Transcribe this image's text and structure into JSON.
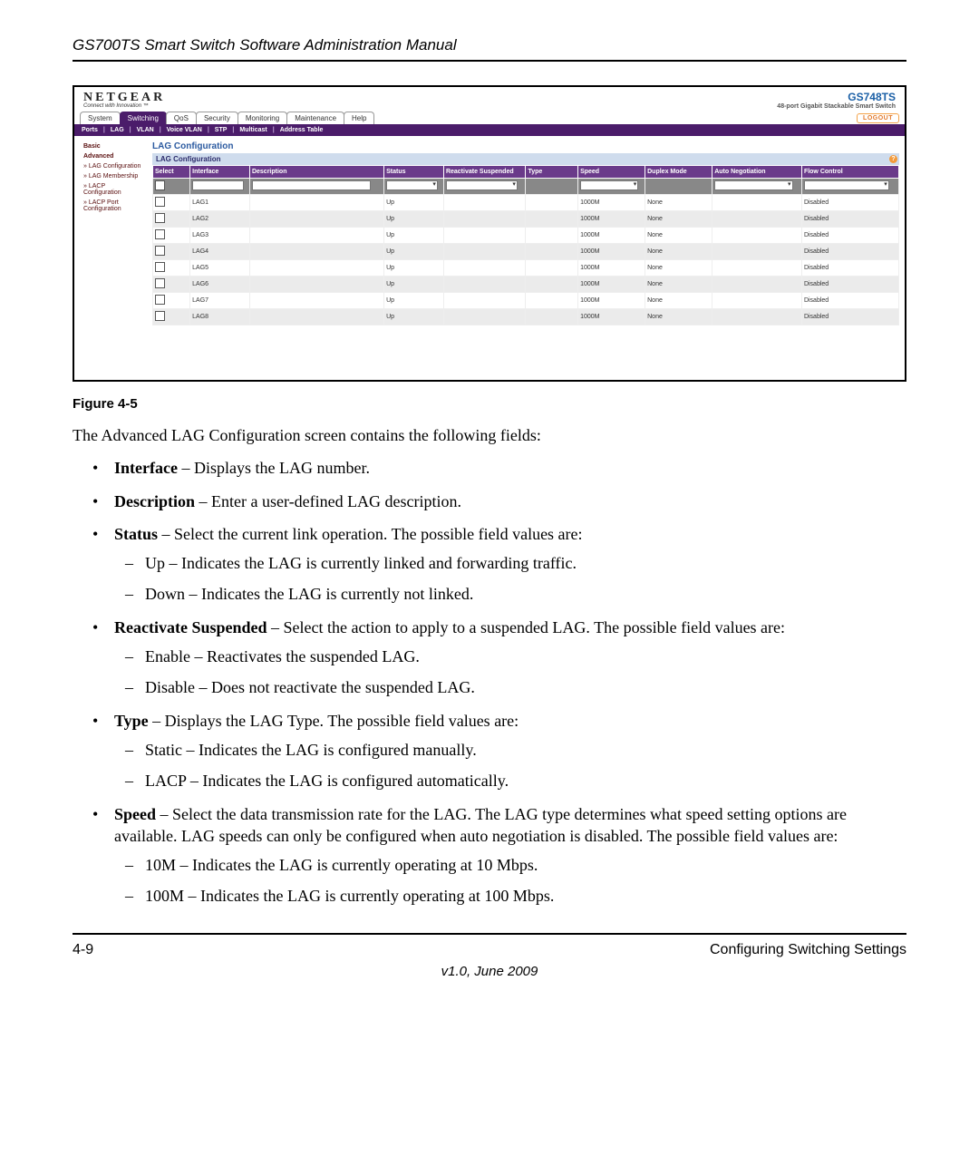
{
  "running_header": "GS700TS Smart Switch Software Administration Manual",
  "figure": {
    "brand": "NETGEAR",
    "brand_tag": "Connect with Innovation ™",
    "product_code": "GS748TS",
    "product_sub": "48-port Gigabit Stackable Smart Switch",
    "nav_tabs": [
      "System",
      "Switching",
      "QoS",
      "Security",
      "Monitoring",
      "Maintenance",
      "Help"
    ],
    "nav_active": "Switching",
    "logout": "LOGOUT",
    "subnav": [
      "Ports",
      "LAG",
      "VLAN",
      "Voice VLAN",
      "STP",
      "Multicast",
      "Address Table"
    ],
    "side": [
      {
        "label": "Basic",
        "cls": "head"
      },
      {
        "label": "Advanced",
        "cls": "head"
      },
      {
        "label": "» LAG Configuration",
        "cls": ""
      },
      {
        "label": "» LAG Membership",
        "cls": ""
      },
      {
        "label": "» LACP Configuration",
        "cls": ""
      },
      {
        "label": "» LACP Port Configuration",
        "cls": ""
      }
    ],
    "section_title": "LAG Configuration",
    "panel_title": "LAG Configuration",
    "columns": [
      "Select",
      "Interface",
      "Description",
      "Status",
      "Reactivate Suspended",
      "Type",
      "Speed",
      "Duplex Mode",
      "Auto Negotiation",
      "Flow Control"
    ],
    "rows": [
      {
        "iface": "LAG1",
        "desc": "",
        "status": "Up",
        "react": "",
        "type": "",
        "speed": "1000M",
        "duplex": "None",
        "auto": "",
        "flow": "Disabled",
        "alt": false
      },
      {
        "iface": "LAG2",
        "desc": "",
        "status": "Up",
        "react": "",
        "type": "",
        "speed": "1000M",
        "duplex": "None",
        "auto": "",
        "flow": "Disabled",
        "alt": true
      },
      {
        "iface": "LAG3",
        "desc": "",
        "status": "Up",
        "react": "",
        "type": "",
        "speed": "1000M",
        "duplex": "None",
        "auto": "",
        "flow": "Disabled",
        "alt": false
      },
      {
        "iface": "LAG4",
        "desc": "",
        "status": "Up",
        "react": "",
        "type": "",
        "speed": "1000M",
        "duplex": "None",
        "auto": "",
        "flow": "Disabled",
        "alt": true
      },
      {
        "iface": "LAG5",
        "desc": "",
        "status": "Up",
        "react": "",
        "type": "",
        "speed": "1000M",
        "duplex": "None",
        "auto": "",
        "flow": "Disabled",
        "alt": false
      },
      {
        "iface": "LAG6",
        "desc": "",
        "status": "Up",
        "react": "",
        "type": "",
        "speed": "1000M",
        "duplex": "None",
        "auto": "",
        "flow": "Disabled",
        "alt": true
      },
      {
        "iface": "LAG7",
        "desc": "",
        "status": "Up",
        "react": "",
        "type": "",
        "speed": "1000M",
        "duplex": "None",
        "auto": "",
        "flow": "Disabled",
        "alt": false
      },
      {
        "iface": "LAG8",
        "desc": "",
        "status": "Up",
        "react": "",
        "type": "",
        "speed": "1000M",
        "duplex": "None",
        "auto": "",
        "flow": "Disabled",
        "alt": true
      }
    ]
  },
  "figure_label": "Figure 4-5",
  "intro": "The Advanced LAG Configuration screen contains the following fields:",
  "bullets": [
    {
      "term": "Interface",
      "text": " – Displays the LAG number."
    },
    {
      "term": "Description",
      "text": " – Enter a user-defined LAG description."
    },
    {
      "term": "Status",
      "text": " – Select the current link operation. The possible field values are:",
      "sub": [
        "Up – Indicates the LAG is currently linked and forwarding traffic.",
        "Down – Indicates the LAG is currently not linked."
      ]
    },
    {
      "term": "Reactivate Suspended",
      "text": " – Select the action to apply to a suspended LAG. The possible field values are:",
      "sub": [
        "Enable – Reactivates the suspended LAG.",
        "Disable – Does not reactivate the suspended LAG."
      ]
    },
    {
      "term": "Type",
      "text": " – Displays the LAG Type. The possible field values are:",
      "sub": [
        "Static – Indicates the LAG is configured manually.",
        "LACP – Indicates the LAG is configured automatically."
      ]
    },
    {
      "term": "Speed",
      "text": " – Select the data transmission rate for the LAG. The LAG type determines what speed setting options are available. LAG speeds can only be configured when auto negotiation is disabled. The possible field values are:",
      "sub": [
        "10M – Indicates the LAG is currently operating at 10 Mbps.",
        "100M – Indicates the LAG is currently operating at 100 Mbps."
      ]
    }
  ],
  "footer": {
    "left": "4-9",
    "right": "Configuring Switching Settings",
    "version": "v1.0, June 2009"
  }
}
